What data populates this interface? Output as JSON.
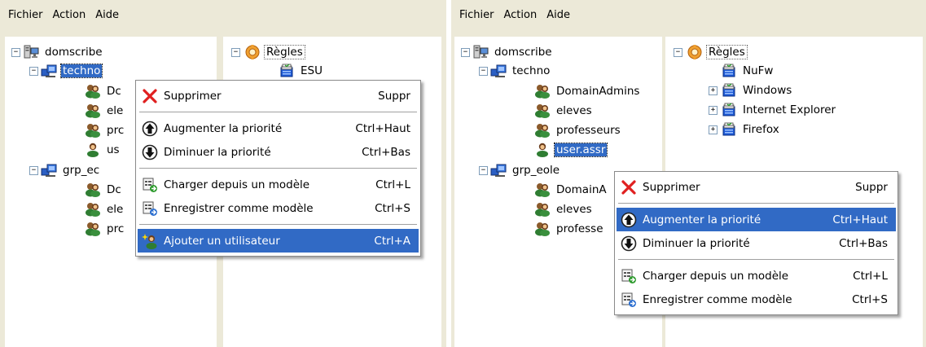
{
  "left": {
    "menubar": [
      "Fichier",
      "Action",
      "Aide"
    ],
    "tree": {
      "root": "domscribe",
      "techno": "techno",
      "children_techno": [
        "Dc",
        "ele",
        "prc",
        "us"
      ],
      "grp": "grp_ec",
      "children_grp": [
        "Dc",
        "ele",
        "prc"
      ]
    },
    "rules": {
      "root": "Règles",
      "items": [
        "ESU"
      ]
    },
    "context_menu": {
      "items": [
        {
          "label": "Supprimer",
          "shortcut": "Suppr",
          "icon": "delete-x-icon"
        },
        {
          "label": "Augmenter la priorité",
          "shortcut": "Ctrl+Haut",
          "icon": "arrow-up-circle-icon"
        },
        {
          "label": "Diminuer la priorité",
          "shortcut": "Ctrl+Bas",
          "icon": "arrow-down-circle-icon"
        },
        {
          "label": "Charger depuis un modèle",
          "shortcut": "Ctrl+L",
          "icon": "load-template-icon"
        },
        {
          "label": "Enregistrer comme modèle",
          "shortcut": "Ctrl+S",
          "icon": "save-template-icon"
        },
        {
          "label": "Ajouter un utilisateur",
          "shortcut": "Ctrl+A",
          "icon": "add-user-icon"
        }
      ],
      "highlighted": "Ajouter un utilisateur"
    }
  },
  "right": {
    "menubar": [
      "Fichier",
      "Action",
      "Aide"
    ],
    "tree": {
      "root": "domscribe",
      "techno": "techno",
      "children_techno": [
        "DomainAdmins",
        "eleves",
        "professeurs",
        "user.assr"
      ],
      "grp": "grp_eole",
      "children_grp": [
        "DomainA",
        "eleves",
        "professe"
      ]
    },
    "rules": {
      "root": "Règles",
      "items": [
        "NuFw",
        "Windows",
        "Internet Explorer",
        "Firefox"
      ]
    },
    "context_menu": {
      "items": [
        {
          "label": "Supprimer",
          "shortcut": "Suppr",
          "icon": "delete-x-icon"
        },
        {
          "label": "Augmenter la priorité",
          "shortcut": "Ctrl+Haut",
          "icon": "arrow-up-circle-icon"
        },
        {
          "label": "Diminuer la priorité",
          "shortcut": "Ctrl+Bas",
          "icon": "arrow-down-circle-icon"
        },
        {
          "label": "Charger depuis un modèle",
          "shortcut": "Ctrl+L",
          "icon": "load-template-icon"
        },
        {
          "label": "Enregistrer comme modèle",
          "shortcut": "Ctrl+S",
          "icon": "save-template-icon"
        }
      ],
      "highlighted": "Augmenter la priorité"
    }
  },
  "colors": {
    "selection": "#316ac5",
    "panel": "#ece9d8",
    "tree_bg": "#ffffff"
  }
}
